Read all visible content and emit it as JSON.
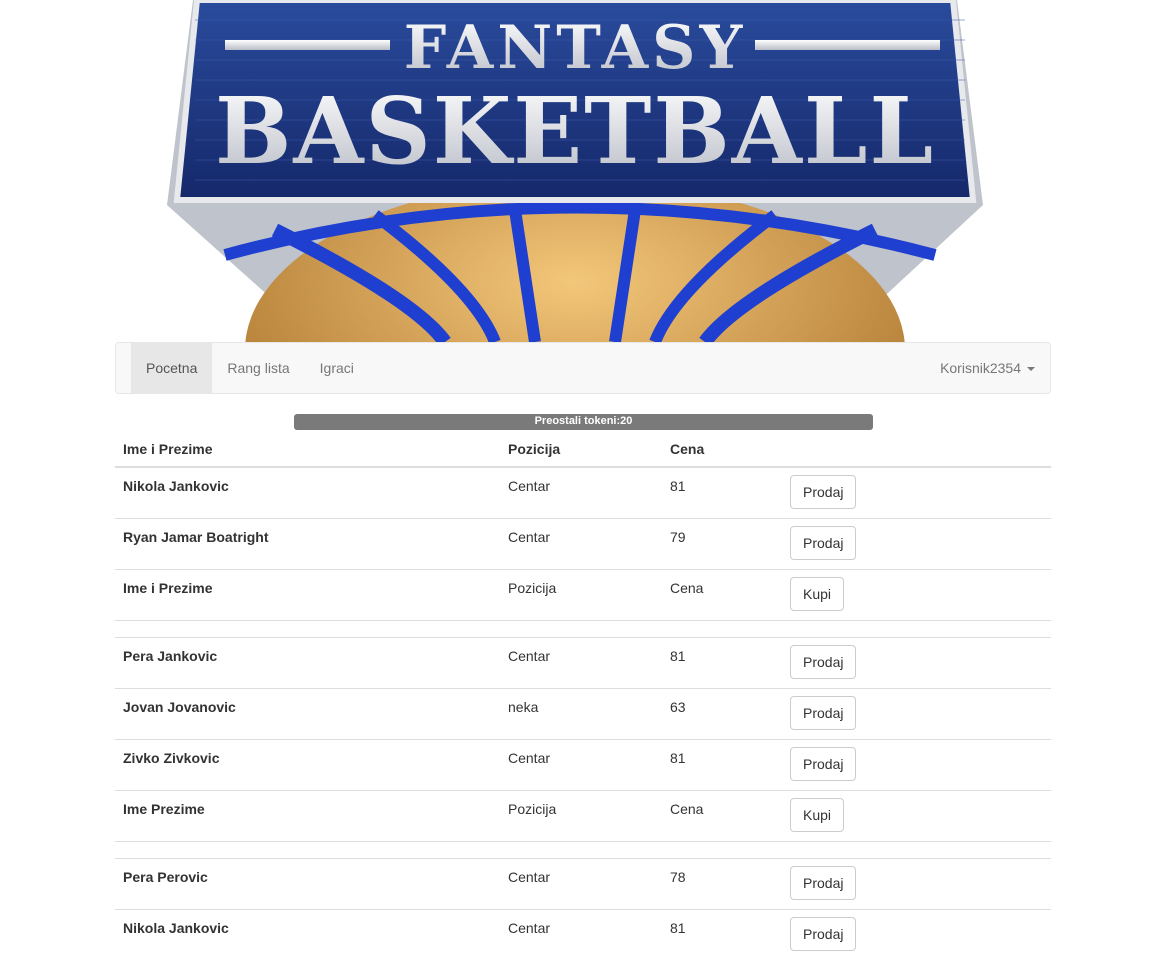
{
  "logo": {
    "line1": "FANTASY",
    "line2": "BASKETBALL",
    "colors": {
      "blue": "#1f3f8f",
      "silver": "#d9dbe0",
      "orange": "#d49a3a"
    }
  },
  "nav": {
    "items": [
      {
        "label": "Pocetna",
        "active": true
      },
      {
        "label": "Rang lista",
        "active": false
      },
      {
        "label": "Igraci",
        "active": false
      }
    ],
    "user": "Korisnik2354"
  },
  "tokens": {
    "label": "Preostali tokeni:20",
    "fill_percent": 100
  },
  "table": {
    "headers": {
      "name": "Ime i Prezime",
      "position": "Pozicija",
      "price": "Cena"
    },
    "rows": [
      {
        "name": "Nikola Jankovic",
        "position": "Centar",
        "price": "81",
        "action": "Prodaj"
      },
      {
        "name": "Ryan Jamar Boatright",
        "position": "Centar",
        "price": "79",
        "action": "Prodaj"
      },
      {
        "name": "Ime i Prezime",
        "position": "Pozicija",
        "price": "Cena",
        "action": "Kupi"
      },
      {
        "spacer": true
      },
      {
        "name": "Pera Jankovic",
        "position": "Centar",
        "price": "81",
        "action": "Prodaj"
      },
      {
        "name": "Jovan Jovanovic",
        "position": "neka",
        "price": "63",
        "action": "Prodaj"
      },
      {
        "name": "Zivko Zivkovic",
        "position": "Centar",
        "price": "81",
        "action": "Prodaj"
      },
      {
        "name": "Ime Prezime",
        "position": "Pozicija",
        "price": "Cena",
        "action": "Kupi"
      },
      {
        "spacer": true
      },
      {
        "name": "Pera Perovic",
        "position": "Centar",
        "price": "78",
        "action": "Prodaj"
      },
      {
        "name": "Nikola Jankovic",
        "position": "Centar",
        "price": "81",
        "action": "Prodaj"
      }
    ]
  }
}
